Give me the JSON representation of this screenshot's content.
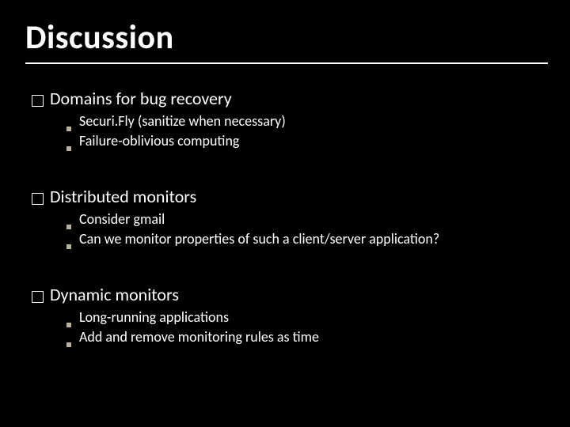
{
  "title": "Discussion",
  "sections": [
    {
      "heading": "Domains for bug recovery",
      "items": [
        "Securi.Fly (sanitize when necessary)",
        "Failure-oblivious computing"
      ]
    },
    {
      "heading": "Distributed monitors",
      "items": [
        "Consider gmail",
        "Can we monitor properties of such a client/server application?"
      ]
    },
    {
      "heading": "Dynamic monitors",
      "items": [
        "Long-running applications",
        "Add and remove monitoring rules as time"
      ]
    }
  ]
}
